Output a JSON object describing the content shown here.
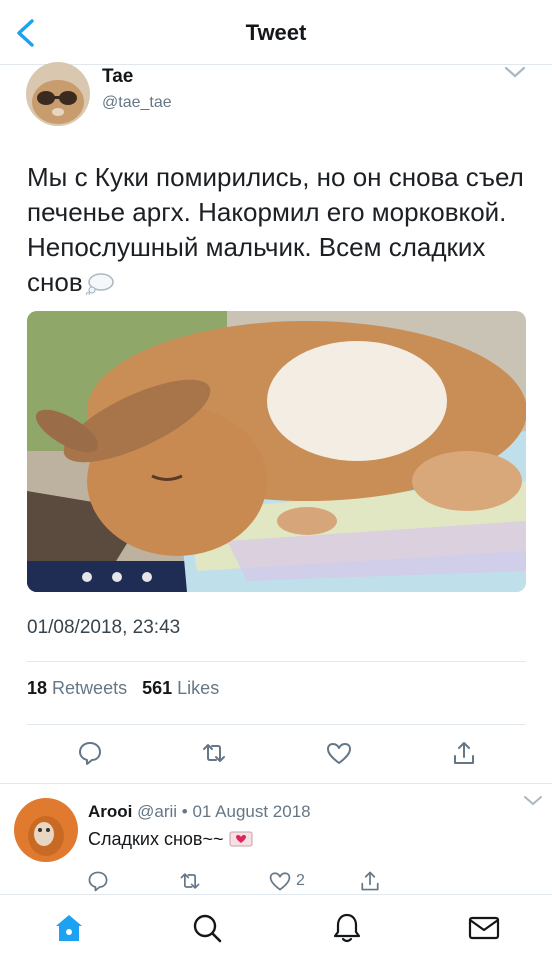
{
  "header": {
    "title": "Tweet",
    "back_icon": "chevron-left-icon"
  },
  "tweet": {
    "author_name": "Tae",
    "author_handle": "@tae_tae",
    "text": "Мы с Куки помирились, но он снова съел печенье аргх. Накормил его морковкой. Непослушный мальчик. Всем сладких снов",
    "emoji_icon": "thought-balloon-icon",
    "timestamp": "01/08/2018, 23:43",
    "retweets_count": "18",
    "retweets_label": "Retweets",
    "likes_count": "561",
    "likes_label": "Likes",
    "photo_icon": "sleeping-rabbit-photo"
  },
  "reply": {
    "author_name": "Arooi",
    "meta": "@arii • 01 August 2018",
    "text": "Сладких снов~~",
    "emoji_icon": "heart-letter-icon",
    "like_count": "2"
  },
  "colors": {
    "accent": "#1da1f2",
    "nav_active": "#1da1f2",
    "muted": "#657786"
  },
  "bottom_nav": [
    "home-icon",
    "search-icon",
    "notifications-icon",
    "messages-icon"
  ]
}
